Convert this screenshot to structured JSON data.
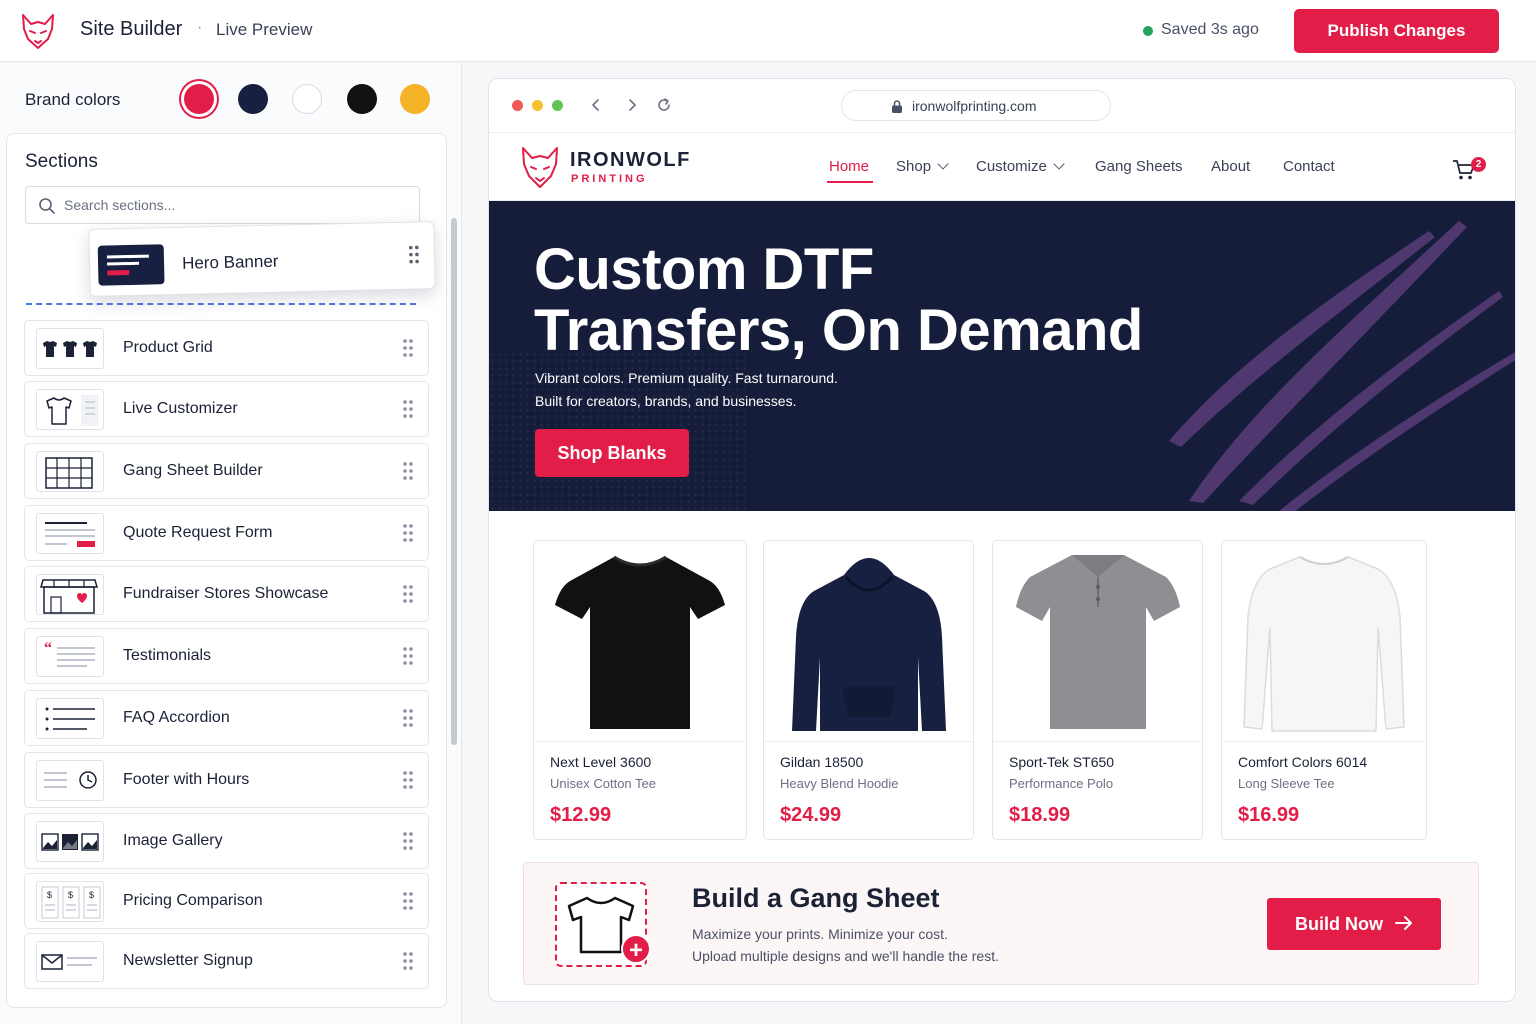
{
  "app": {
    "title": "Site Builder",
    "separator": "·",
    "subtitle": "Live Preview",
    "saved_status": "Saved 3s ago",
    "publish_label": "Publish Changes"
  },
  "brand": {
    "label": "Brand colors",
    "colors": [
      "#e11d48",
      "#172040",
      "#ffffff",
      "#111111",
      "#f5b328"
    ],
    "selected_index": 0
  },
  "sections": {
    "title": "Sections",
    "search_placeholder": "Search sections...",
    "dragging_item": "Hero Banner",
    "items": [
      {
        "label": "Product Grid",
        "icon": "product-grid-thumb"
      },
      {
        "label": "Live Customizer",
        "icon": "tshirt-thumb"
      },
      {
        "label": "Gang Sheet Builder",
        "icon": "grid-thumb"
      },
      {
        "label": "Quote Request Form",
        "icon": "form-thumb"
      },
      {
        "label": "Fundraiser Stores Showcase",
        "icon": "storefront-thumb"
      },
      {
        "label": "Testimonials",
        "icon": "quote-thumb"
      },
      {
        "label": "FAQ Accordion",
        "icon": "list-thumb"
      },
      {
        "label": "Footer with Hours",
        "icon": "clock-thumb"
      },
      {
        "label": "Image Gallery",
        "icon": "gallery-thumb"
      },
      {
        "label": "Pricing Comparison",
        "icon": "pricing-thumb"
      },
      {
        "label": "Newsletter Signup",
        "icon": "mail-thumb"
      }
    ]
  },
  "preview": {
    "url": "ironwolfprinting.com",
    "logo_name": "IRONWOLF",
    "logo_sub": "PRINTING",
    "nav": [
      {
        "label": "Home",
        "active": true
      },
      {
        "label": "Shop",
        "dropdown": true
      },
      {
        "label": "Customize",
        "dropdown": true
      },
      {
        "label": "Gang Sheets"
      },
      {
        "label": "About"
      },
      {
        "label": "Contact"
      }
    ],
    "cart_count": "2",
    "hero": {
      "title_line1": "Custom DTF",
      "title_line2": "Transfers, On Demand",
      "sub_line1": "Vibrant colors. Premium quality. Fast turnaround.",
      "sub_line2": "Built for creators, brands, and businesses.",
      "cta": "Shop Blanks"
    },
    "products": [
      {
        "name": "Next Level 3600",
        "desc": "Unisex Cotton Tee",
        "price": "$12.99",
        "color": "#111111",
        "type": "tee"
      },
      {
        "name": "Gildan 18500",
        "desc": "Heavy Blend Hoodie",
        "price": "$24.99",
        "color": "#172040",
        "type": "hoodie"
      },
      {
        "name": "Sport-Tek ST650",
        "desc": "Performance Polo",
        "price": "$18.99",
        "color": "#8e8f93",
        "type": "polo"
      },
      {
        "name": "Comfort Colors 6014",
        "desc": "Long Sleeve Tee",
        "price": "$16.99",
        "color": "#f4f4f4",
        "type": "longsleeve"
      }
    ],
    "gang": {
      "title": "Build a Gang Sheet",
      "line1": "Maximize your prints. Minimize your cost.",
      "line2": "Upload multiple designs and we'll handle the rest.",
      "cta": "Build Now"
    }
  }
}
